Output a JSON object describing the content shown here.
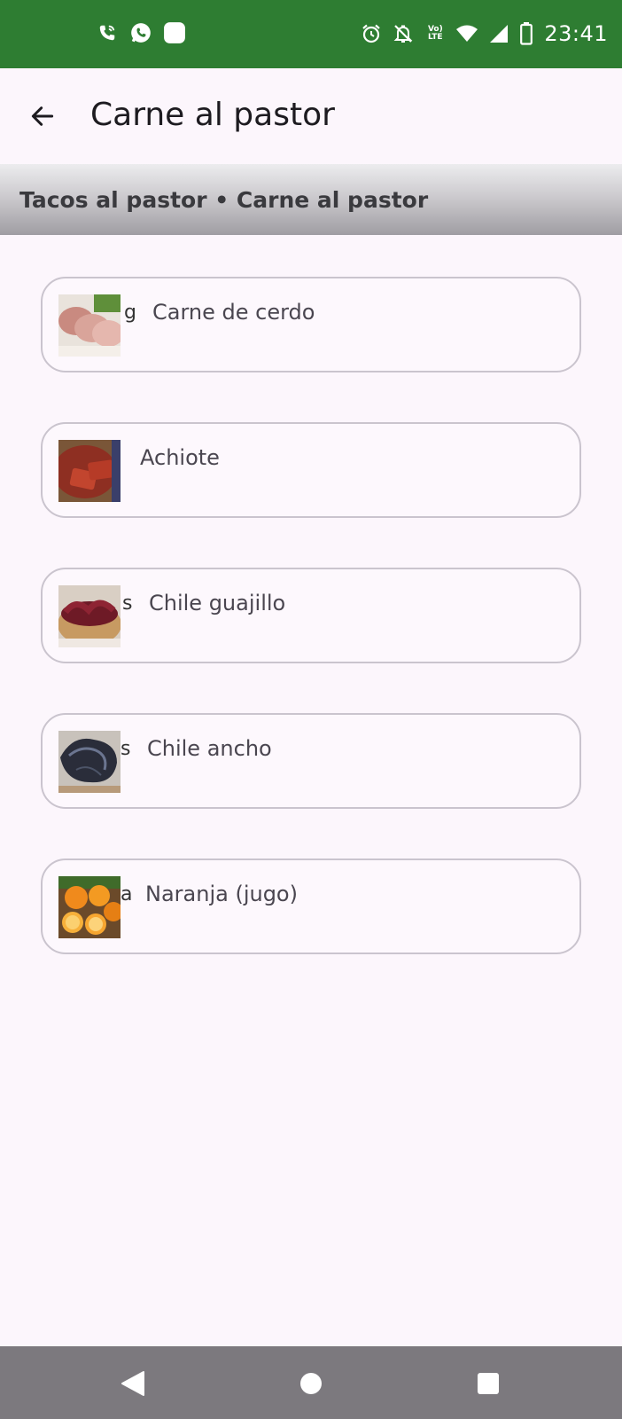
{
  "status_bar": {
    "time": "23:41",
    "lte_top": "Vo)",
    "lte_bottom": "LTE",
    "left_icons": [
      "phone-wifi-icon",
      "whatsapp-icon",
      "app-square-icon"
    ],
    "right_icons": [
      "alarm-icon",
      "bell-off-icon",
      "volte-icon",
      "wifi-icon",
      "cell-signal-icon",
      "battery-icon"
    ]
  },
  "app_bar": {
    "title": "Carne al pastor",
    "back_icon": "arrow-back-icon"
  },
  "breadcrumb": "Tacos al pastor • Carne al pastor",
  "ingredients": [
    {
      "letter": "g",
      "label": "Carne de cerdo",
      "image": "pork-meat-thumb"
    },
    {
      "letter": "",
      "label": "Achiote",
      "image": "achiote-thumb"
    },
    {
      "letter": "s",
      "label": "Chile guajillo",
      "image": "guajillo-thumb"
    },
    {
      "letter": "s",
      "label": "Chile ancho",
      "image": "ancho-thumb"
    },
    {
      "letter": "a",
      "label": "Naranja (jugo)",
      "image": "orange-thumb"
    }
  ],
  "nav_bar": [
    "nav-back-icon",
    "nav-home-icon",
    "nav-recents-icon"
  ],
  "colors": {
    "status_bar": "#2e7d32",
    "background": "#fcf6fc",
    "card_border": "#cac4ce",
    "nav_bar": "#7c797e"
  }
}
